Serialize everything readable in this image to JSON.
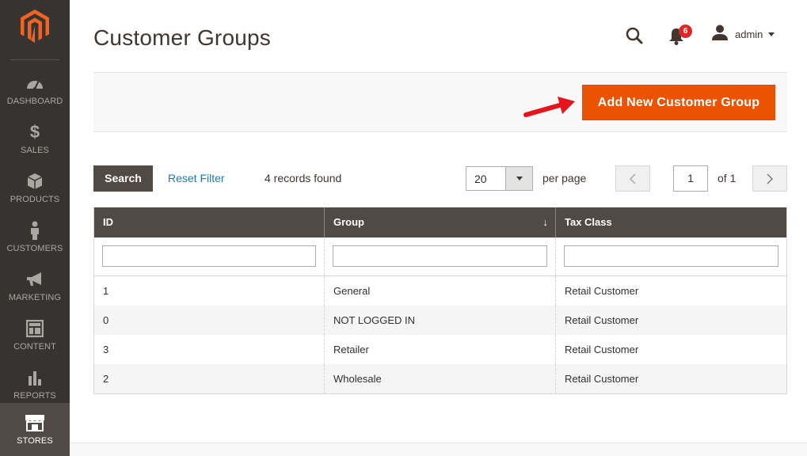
{
  "sidebar": {
    "logo": "magento-logo",
    "items": [
      {
        "label": "DASHBOARD",
        "icon": "dashboard-icon"
      },
      {
        "label": "SALES",
        "icon": "dollar-icon"
      },
      {
        "label": "PRODUCTS",
        "icon": "box-icon"
      },
      {
        "label": "CUSTOMERS",
        "icon": "person-icon"
      },
      {
        "label": "MARKETING",
        "icon": "megaphone-icon"
      },
      {
        "label": "CONTENT",
        "icon": "layout-icon"
      },
      {
        "label": "REPORTS",
        "icon": "bar-chart-icon"
      },
      {
        "label": "STORES",
        "icon": "store-icon",
        "active": true
      }
    ]
  },
  "header": {
    "title": "Customer Groups",
    "notification_count": "6",
    "user": "admin"
  },
  "actions": {
    "add_button": "Add New Customer Group"
  },
  "toolbar": {
    "search_button": "Search",
    "reset_filter": "Reset Filter",
    "records_found": "4 records found",
    "per_page_value": "20",
    "per_page_label": "per page",
    "page_current": "1",
    "page_of": "of 1"
  },
  "grid": {
    "columns": [
      "ID",
      "Group",
      "Tax Class"
    ],
    "sort_indicator": "↓",
    "rows": [
      [
        "1",
        "General",
        "Retail Customer"
      ],
      [
        "0",
        "NOT LOGGED IN",
        "Retail Customer"
      ],
      [
        "3",
        "Retailer",
        "Retail Customer"
      ],
      [
        "2",
        "Wholesale",
        "Retail Customer"
      ]
    ]
  },
  "colors": {
    "sidebar_bg": "#373330",
    "accent": "#eb5202",
    "grid_header": "#514943",
    "link": "#1979c3",
    "badge": "#e22626"
  }
}
